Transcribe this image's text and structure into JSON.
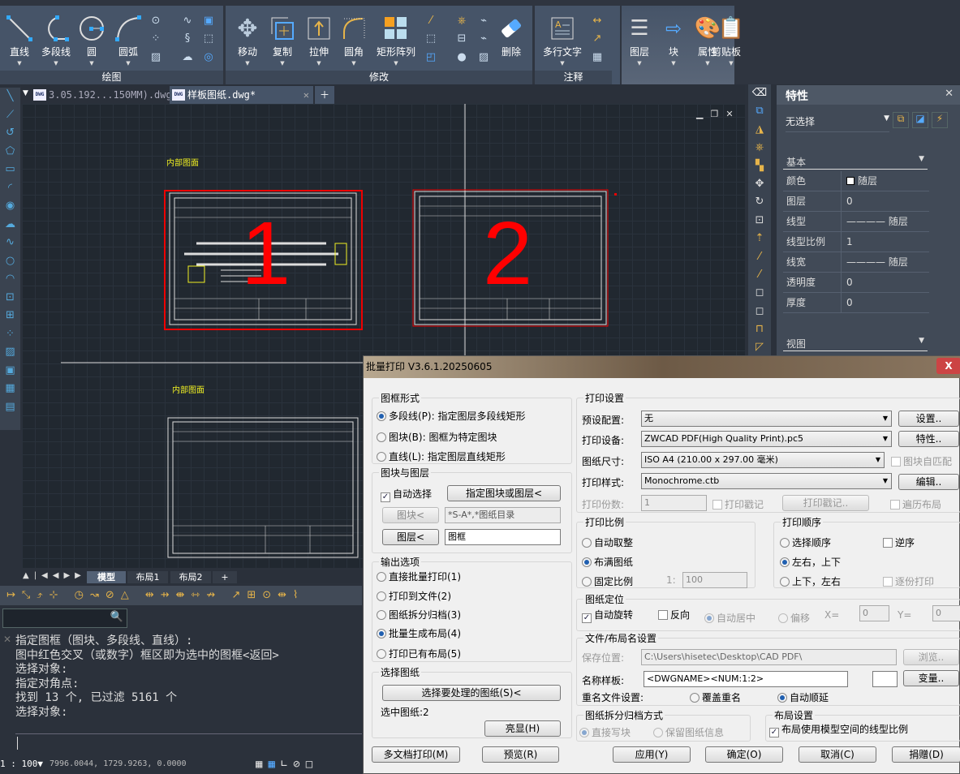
{
  "ribbon": {
    "draw": {
      "label": "绘图",
      "buttons": [
        "直线",
        "多段线",
        "圆",
        "圆弧"
      ]
    },
    "modify": {
      "label": "修改",
      "buttons": [
        "移动",
        "复制",
        "拉伸",
        "圆角",
        "矩形阵列",
        "删除"
      ]
    },
    "annotate": {
      "label": "注释",
      "buttons": [
        "多行文字"
      ]
    },
    "extra": [
      "图层",
      "块",
      "属性",
      "剪贴板"
    ]
  },
  "tabs": [
    {
      "label": "3.05.192...150MM).dwg*",
      "active": false
    },
    {
      "label": "样板图纸.dwg*",
      "active": true
    }
  ],
  "canvas": {
    "label1": "内部图面",
    "label2": "内部图面",
    "frame1_number": "1",
    "frame2_number": "2",
    "highlight_color": "#ff0000"
  },
  "layout_tabs": [
    "模型",
    "布局1",
    "布局2",
    "+"
  ],
  "command": {
    "lines": [
      "指定图框（图块、多段线、直线）:",
      "图中红色交叉（或数字）框区即为选中的图框<返回>",
      "选择对象:",
      "指定对角点:",
      "找到 13 个, 已过滤 5161 个",
      "选择对象:"
    ]
  },
  "status": {
    "scale": "1 : 100",
    "coords": "7996.0044, 1729.9263, 0.0000"
  },
  "properties": {
    "title": "特性",
    "selection": "无选择",
    "section_basic": "基本",
    "section_view": "视图",
    "rows": [
      {
        "k": "颜色",
        "v": "随层"
      },
      {
        "k": "图层",
        "v": "0"
      },
      {
        "k": "线型",
        "v": "———— 随层"
      },
      {
        "k": "线型比例",
        "v": "1"
      },
      {
        "k": "线宽",
        "v": "———— 随层"
      },
      {
        "k": "透明度",
        "v": "0"
      },
      {
        "k": "厚度",
        "v": "0"
      }
    ]
  },
  "dialog": {
    "title": "批量打印 V3.6.1.20250605",
    "frame_type": {
      "title": "图框形式",
      "options": [
        "多段线(P): 指定图层多段线矩形",
        "图块(B): 图框为特定图块",
        "直线(L): 指定图层直线矩形"
      ],
      "selected": 0
    },
    "block_layer": {
      "title": "图块与图层",
      "auto_select": "自动选择",
      "auto_select_checked": true,
      "specify_btn": "指定图块或图层<",
      "block_btn": "图块<",
      "block_value": "*S-A*,*图纸目录",
      "layer_btn": "图层<",
      "layer_value": "图框"
    },
    "output": {
      "title": "输出选项",
      "options": [
        "直接批量打印(1)",
        "打印到文件(2)",
        "图纸拆分归档(3)",
        "批量生成布局(4)",
        "打印已有布局(5)"
      ],
      "selected": 3
    },
    "select_sheets": {
      "title": "选择图纸",
      "select_btn": "选择要处理的图纸(S)<",
      "count_text": "选中图纸:2",
      "highlight_btn": "亮显(H)"
    },
    "print_settings": {
      "title": "打印设置",
      "preset_label": "预设配置:",
      "preset": "无",
      "setup_btn": "设置..",
      "device_label": "打印设备:",
      "device": "ZWCAD PDF(High Quality Print).pc5",
      "props_btn": "特性..",
      "paper_label": "图纸尺寸:",
      "paper": "ISO A4 (210.00 x 297.00 毫米)",
      "block_match": "图块自匹配",
      "style_label": "打印样式:",
      "style": "Monochrome.ctb",
      "edit_btn": "编辑..",
      "copies_label": "打印份数:",
      "copies": "1",
      "stamp_cb": "打印戳记",
      "stamp_btn": "打印戳记..",
      "traverse": "遍历布局"
    },
    "scale": {
      "title": "打印比例",
      "options": [
        "自动取整",
        "布满图纸",
        "固定比例"
      ],
      "selected": 1,
      "ratio_prefix": "1:",
      "ratio": "100"
    },
    "order": {
      "title": "打印顺序",
      "options": [
        "选择顺序",
        "左右，上下",
        "上下，左右"
      ],
      "selected": 1,
      "reverse": "逆序",
      "collate": "逐份打印"
    },
    "position": {
      "title": "图纸定位",
      "auto_rotate": "自动旋转",
      "auto_rotate_checked": true,
      "reverse": "反向",
      "center": "自动居中",
      "offset": "偏移",
      "x_label": "X=",
      "x": "0",
      "y_label": "Y=",
      "y": "0"
    },
    "file": {
      "title": "文件/布局名设置",
      "save_label": "保存位置:",
      "save_path": "C:\\Users\\hisetec\\Desktop\\CAD PDF\\",
      "browse_btn": "浏览..",
      "name_label": "名称样板:",
      "name_template": "<DWGNAME><NUM:1:2>",
      "var_btn": "变量..",
      "rename_label": "重名文件设置:",
      "overwrite": "覆盖重名",
      "auto_inc": "自动顺延"
    },
    "split": {
      "title": "图纸拆分归档方式",
      "options": [
        "直接写块",
        "保留图纸信息"
      ]
    },
    "layout": {
      "title": "布局设置",
      "option": "布局使用模型空间的线型比例",
      "checked": true
    },
    "buttons": {
      "multi": "多文档打印(M)",
      "preview": "预览(R)",
      "apply": "应用(Y)",
      "ok": "确定(O)",
      "cancel": "取消(C)",
      "donate": "捐赠(D)"
    }
  }
}
